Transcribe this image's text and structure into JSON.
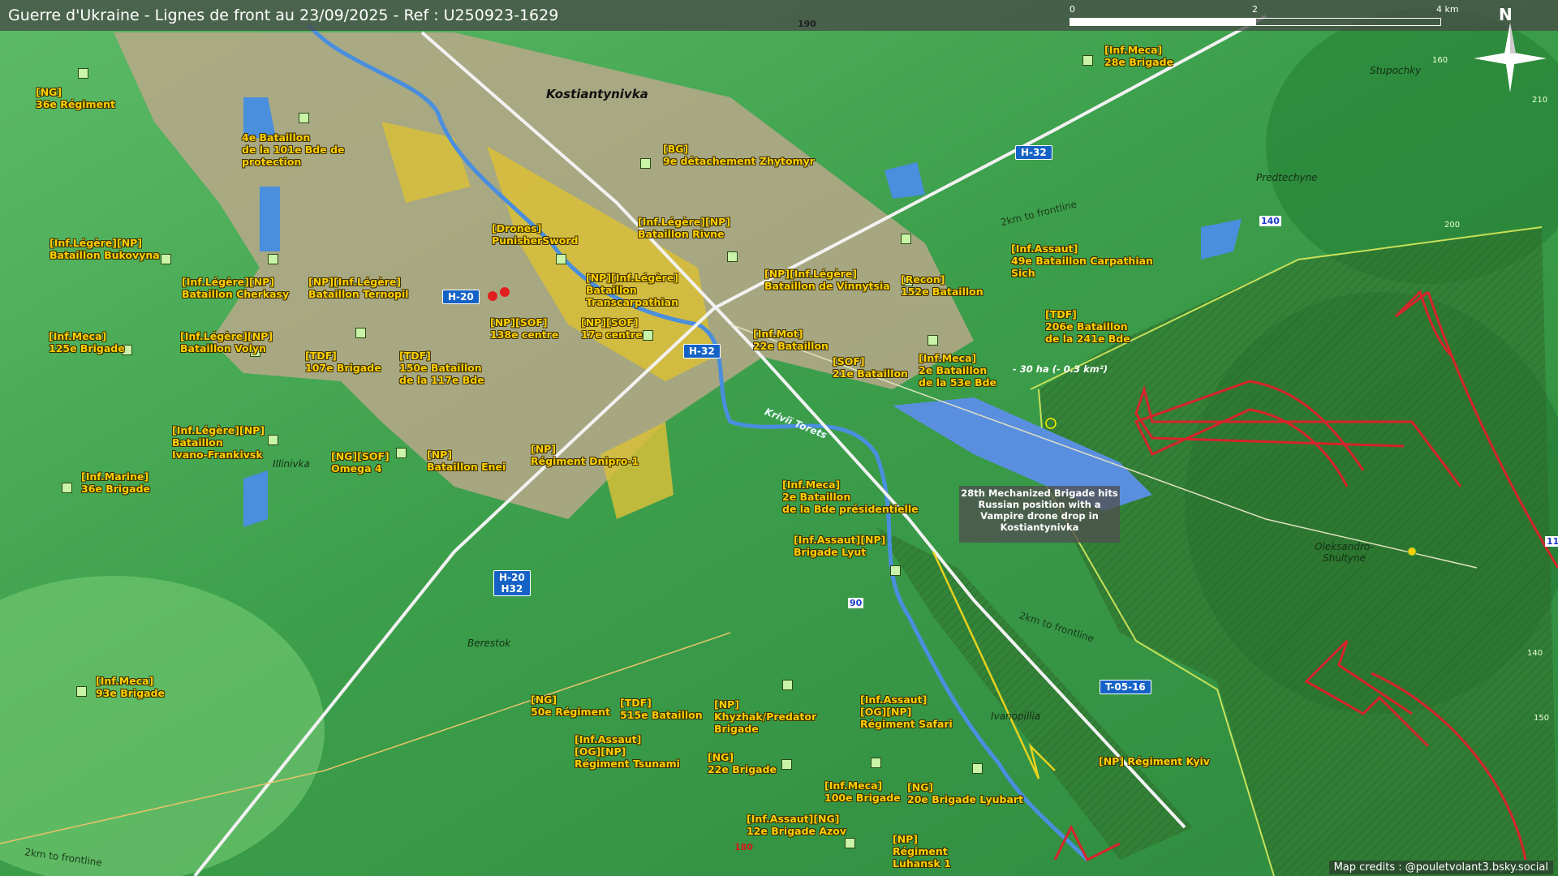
{
  "title": "Guerre d'Ukraine - Lignes de front au 23/09/2025 - Ref : U250923-1629",
  "scale": {
    "l0": "0",
    "l1": "2",
    "l2": "4 km"
  },
  "north": "N",
  "colors": {
    "front": "#d6242a",
    "unit_text": "#ffd000",
    "road_badge": "#1562c7",
    "urban": "#b9a88a"
  },
  "places": {
    "kostiantynivka": "Kostiantynivka",
    "predtechyne": "Predtechyne",
    "stupochky": "Stupochky",
    "illinivka": "Illinivka",
    "berestok": "Berestok",
    "ivanopillia": "Ivanopillia",
    "oleksandro": "Oleksandro-",
    "shultyne": "Shultyne",
    "krivii_torets": "Kriviï Torets"
  },
  "roads": {
    "h20_a": "H-20",
    "h32_a": "H-32",
    "h32_b": "H-32",
    "h20h32_1": "H-20",
    "h20h32_2": "H32",
    "t0516": "T-05-16"
  },
  "road_numbers": {
    "n190": "190",
    "n140": "140",
    "n90": "90",
    "n180": "180",
    "n11": "11"
  },
  "altitudes": {
    "a160": "160",
    "a210": "210",
    "a200": "200",
    "a140": "140",
    "a150": "150"
  },
  "frontline": {
    "l1": "2km to frontline",
    "l2": "2km to frontline",
    "l3": "2km to frontline"
  },
  "area": "- 30 ha (- 0.3 km²)",
  "event": {
    "l1": "28th Mechanized Brigade hits",
    "l2": "Russian position with a",
    "l3": "Vampire drone drop in",
    "l4": "Kostiantynivka"
  },
  "units": {
    "u1": {
      "a": "[NG]",
      "b": "36e Régiment"
    },
    "u2": {
      "a": "4e Bataillon",
      "b": "de la 101e Bde de",
      "c": "protection"
    },
    "u3": {
      "a": "[BG]",
      "b": "9e détachement Zhytomyr"
    },
    "u4": {
      "a": "[Inf.Meca]",
      "b": "28e Brigade"
    },
    "u5": {
      "a": "[Drones]",
      "b": "PunisherSword"
    },
    "u6": {
      "a": "[Inf.Légère][NP]",
      "b": "Bataillon Rivne"
    },
    "u7": {
      "a": "[Inf.Légère][NP]",
      "b": "Bataillon Bukovyna"
    },
    "u8": {
      "a": "[Inf.Légère][NP]",
      "b": "Bataillon Cherkasy"
    },
    "u9": {
      "a": "[NP][Inf.Légère]",
      "b": "Bataillon Ternopil"
    },
    "u10": {
      "a": "[NP][Inf.Légère]",
      "b": "Bataillon",
      "c": "Transcarpathian"
    },
    "u11": {
      "a": "[NP][Inf.Légère]",
      "b": "Bataillon de Vinnytsia"
    },
    "u12": {
      "a": "[Inf.Assaut]",
      "b": "49e Bataillon Carpathian",
      "c": "Sich"
    },
    "u13": {
      "a": "[Recon]",
      "b": "152e Bataillon"
    },
    "u14": {
      "a": "[Inf.Meca]",
      "b": "125e Brigade"
    },
    "u15": {
      "a": "[Inf.Légère][NP]",
      "b": "Bataillon Volyn"
    },
    "u16": {
      "a": "[NP][SOF]",
      "b": "138e centre"
    },
    "u17": {
      "a": "[NP][SOF]",
      "b": "17e centre"
    },
    "u18": {
      "a": "[Inf.Mot]",
      "b": "22e Bataillon"
    },
    "u19": {
      "a": "[TDF]",
      "b": "206e Bataillon",
      "c": "de la 241e Bde"
    },
    "u20": {
      "a": "[TDF]",
      "b": "107e Brigade"
    },
    "u21": {
      "a": "[TDF]",
      "b": "150e Bataillon",
      "c": "de la 117e Bde"
    },
    "u22": {
      "a": "[SOF]",
      "b": "21e Bataillon"
    },
    "u23": {
      "a": "[Inf.Meca]",
      "b": "2e Bataillon",
      "c": "de la 53e Bde"
    },
    "u24": {
      "a": "[Inf.Légère][NP]",
      "b": "Bataillon",
      "c": "Ivano-Frankivsk"
    },
    "u25": {
      "a": "[NG][SOF]",
      "b": "Omega 4"
    },
    "u26": {
      "a": "[NP]",
      "b": "Bataillon Enei"
    },
    "u27": {
      "a": "[NP]",
      "b": "Régiment Dnipro-1"
    },
    "u28": {
      "a": "[Inf.Marine]",
      "b": "36e Brigade"
    },
    "u29": {
      "a": "[Inf.Meca]",
      "b": "2e Bataillon",
      "c": "de la Bde présidentielle"
    },
    "u30": {
      "a": "[Inf.Assaut][NP]",
      "b": "Brigade Lyut"
    },
    "u31": {
      "a": "[Inf.Meca]",
      "b": "93e Brigade"
    },
    "u32": {
      "a": "[NG]",
      "b": "50e Régiment"
    },
    "u33": {
      "a": "[TDF]",
      "b": "515e Bataillon"
    },
    "u34": {
      "a": "[NP]",
      "b": "Khyzhak/Predator",
      "c": "Brigade"
    },
    "u35": {
      "a": "[Inf.Assaut]",
      "b": "[OG][NP]",
      "c": "Régiment Safari"
    },
    "u36": {
      "a": "[Inf.Assaut]",
      "b": "[OG][NP]",
      "c": "Régiment Tsunami"
    },
    "u37": {
      "a": "[NG]",
      "b": "22e Brigade"
    },
    "u38": {
      "a": "[NP] Régiment Kyiv"
    },
    "u39": {
      "a": "[Inf.Meca]",
      "b": "100e Brigade"
    },
    "u40": {
      "a": "[NG]",
      "b": "20e Brigade Lyubart"
    },
    "u41": {
      "a": "[Inf.Assaut][NG]",
      "b": "12e Brigade Azov"
    },
    "u42": {
      "a": "[NP]",
      "b": "Régiment",
      "c": "Luhansk 1"
    }
  },
  "credits": "Map credits : @pouletvolant3.bsky.social"
}
